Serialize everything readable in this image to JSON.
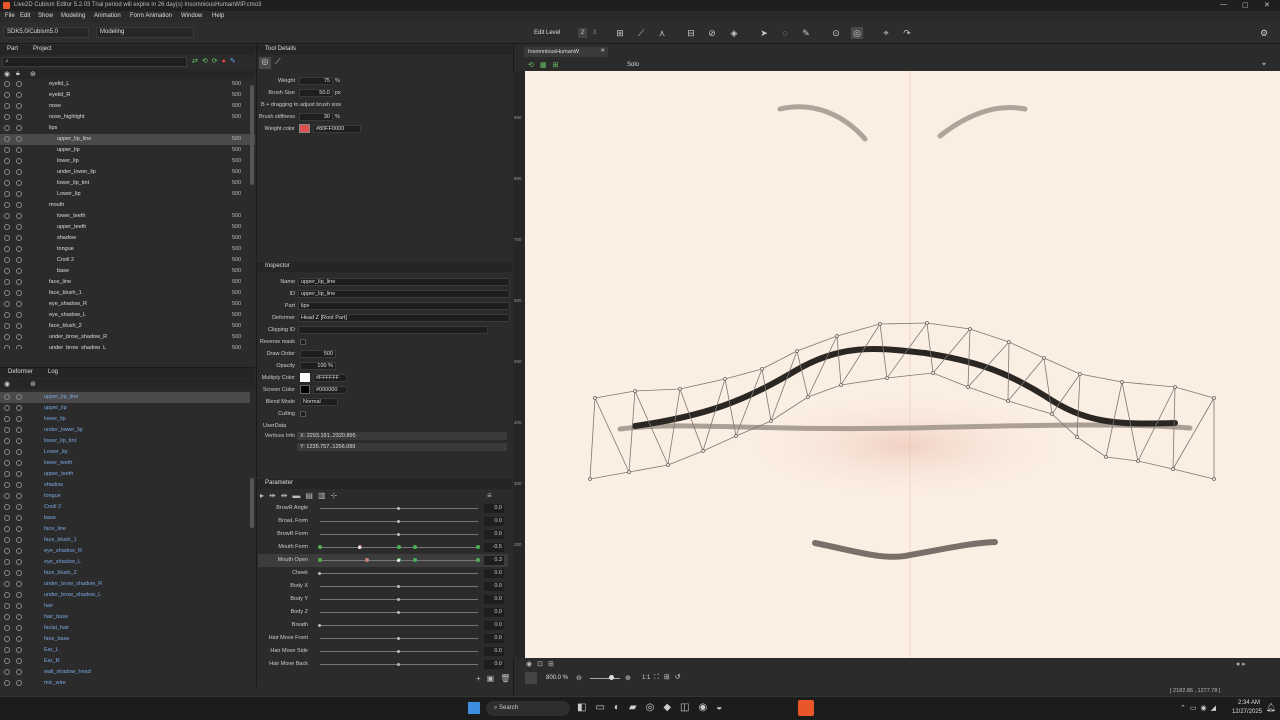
{
  "title": "Live2D Cubism Editor 5.2.03   Trial period will expire in 26 day(s)   InsomniousHumanWIP.cmo3",
  "menu": [
    "File",
    "Edit",
    "Show",
    "Modeling",
    "Animation",
    "Form Animation",
    "Window",
    "Help"
  ],
  "toolbar": {
    "sdk": "SDK5.0/Cubism5.0",
    "mode": "Modeling",
    "edit_level_label": "Edit Level",
    "levels": [
      "2",
      "3"
    ]
  },
  "part_panel": {
    "tabs": [
      "Part",
      "Project"
    ],
    "rows": [
      {
        "name": "eyelid_L",
        "dn": "500",
        "indent": 53
      },
      {
        "name": "eyelid_R",
        "dn": "500",
        "indent": 53
      },
      {
        "name": "nose",
        "dn": "500",
        "indent": 53
      },
      {
        "name": "nose_highlight",
        "dn": "500",
        "indent": 53
      },
      {
        "name": "lips",
        "dn": "",
        "indent": 53
      },
      {
        "name": "upper_lip_line",
        "dn": "500",
        "indent": 61,
        "selected": true
      },
      {
        "name": "upper_lip",
        "dn": "500",
        "indent": 61
      },
      {
        "name": "lower_lip",
        "dn": "500",
        "indent": 61
      },
      {
        "name": "under_lower_lip",
        "dn": "500",
        "indent": 61
      },
      {
        "name": "lower_lip_tint",
        "dn": "500",
        "indent": 61
      },
      {
        "name": "Lower_lip",
        "dn": "500",
        "indent": 61
      },
      {
        "name": "mouth",
        "dn": "",
        "indent": 53
      },
      {
        "name": "lower_teeth",
        "dn": "500",
        "indent": 61
      },
      {
        "name": "upper_teeth",
        "dn": "500",
        "indent": 61
      },
      {
        "name": "shadow",
        "dn": "500",
        "indent": 61
      },
      {
        "name": "tongue",
        "dn": "500",
        "indent": 61
      },
      {
        "name": "Cnoll 2",
        "dn": "500",
        "indent": 61
      },
      {
        "name": "base",
        "dn": "500",
        "indent": 61
      },
      {
        "name": "face_line",
        "dn": "500",
        "indent": 53
      },
      {
        "name": "face_blush_1",
        "dn": "500",
        "indent": 53
      },
      {
        "name": "eye_shadow_R",
        "dn": "500",
        "indent": 53
      },
      {
        "name": "eye_shadow_L",
        "dn": "500",
        "indent": 53
      },
      {
        "name": "face_blush_2",
        "dn": "500",
        "indent": 53
      },
      {
        "name": "under_brow_shadow_R",
        "dn": "500",
        "indent": 53
      },
      {
        "name": "under_brow_shadow_L",
        "dn": "500",
        "indent": 53
      }
    ]
  },
  "deformer_panel": {
    "tabs": [
      "Deformer",
      "Log"
    ],
    "rows": [
      "upper_lip_line",
      "upper_lip",
      "lower_lip",
      "under_lower_lip",
      "lower_lip_tint",
      "Lower_lip",
      "lower_teeth",
      "upper_teeth",
      "shadow",
      "tongue",
      "Cnoll 2",
      "base",
      "face_line",
      "face_blush_1",
      "eye_shadow_R",
      "eye_shadow_L",
      "face_blush_2",
      "under_brow_shadow_R",
      "under_brow_shadow_L",
      "hair",
      "hair_base",
      "facial_hair",
      "face_base",
      "Ear_L",
      "Ear_R",
      "wall_shadow_head",
      "mic_wire"
    ]
  },
  "tool_details": {
    "header": "Tool Details",
    "weight_label": "Weight",
    "weight": "75",
    "pct": "%",
    "brush_size_label": "Brush Size",
    "brush_size": "50.0",
    "px": "px",
    "hint": "B + dragging to adjust brush size",
    "stiff_label": "Brush stiffness",
    "stiff": "30",
    "color_label": "Weight color",
    "color": "#80FF0000"
  },
  "inspector": {
    "header": "Inspector",
    "name_label": "Name",
    "name": "upper_lip_line",
    "id_label": "ID",
    "id": "upper_lip_line",
    "part_label": "Part",
    "part": "lips",
    "deformer_label": "Deformer",
    "deformer": "Head Z [Root Part]",
    "clip_label": "Clipping ID",
    "reverse_label": "Reverse mask",
    "draw_label": "Draw Order",
    "draw": "500",
    "opacity_label": "Opacity",
    "opacity": "100 %",
    "multiply_label": "Multiply Color",
    "multiply": "#FFFFFF",
    "screen_label": "Screen Color",
    "screen": "#000000",
    "blend_label": "Blend Mode",
    "blend": "Normal",
    "culling_label": "Culling",
    "userdata_label": "UserData",
    "vertices_label": "Vertices Info",
    "vx": "X: 2293.191..2320.895",
    "vy": "Y: 1235.757..1256.089"
  },
  "parameters": {
    "header": "Parameter",
    "rows": [
      {
        "name": "BrowR Angle",
        "value": "0.0",
        "pos": 0.5
      },
      {
        "name": "BrowL Form",
        "value": "0.0",
        "pos": 0.5
      },
      {
        "name": "BrowR Form",
        "value": "0.0",
        "pos": 0.5
      },
      {
        "name": "Mouth Form",
        "value": "-0.5",
        "pos": 0.25,
        "keys": [
          0,
          0.25,
          0.5,
          0.6,
          1
        ]
      },
      {
        "name": "Mouth Open",
        "value": "0.3",
        "pos": 0.5,
        "keys": [
          0,
          0.3,
          0.5,
          0.6,
          1
        ],
        "selected": true
      },
      {
        "name": "Cheek",
        "value": "0.0",
        "pos": 0
      },
      {
        "name": "Body X",
        "value": "0.0",
        "pos": 0.5
      },
      {
        "name": "Body Y",
        "value": "0.0",
        "pos": 0.5
      },
      {
        "name": "Body Z",
        "value": "0.0",
        "pos": 0.5
      },
      {
        "name": "Breath",
        "value": "0.0",
        "pos": 0
      },
      {
        "name": "Hair Move Front",
        "value": "0.0",
        "pos": 0.5
      },
      {
        "name": "Hair Move Side",
        "value": "0.0",
        "pos": 0.5
      },
      {
        "name": "Hair Move Back",
        "value": "0.0",
        "pos": 0.5
      }
    ]
  },
  "viewport": {
    "tab": "InsomniousHumanW",
    "solo": "Solo",
    "zoom": "800.0 %",
    "ratio": "1:1",
    "coords": "[ 2182.86 , 1277.78 ]",
    "ruler": [
      "900",
      "800",
      "700",
      "600",
      "500",
      "400",
      "300",
      "200"
    ]
  },
  "taskbar": {
    "search": "Search",
    "time": "2:34 AM",
    "date": "12/27/2025"
  },
  "colors": {
    "accent": "#3d8ee0",
    "canvas": "#fbeee2",
    "weight": "#e05050"
  }
}
